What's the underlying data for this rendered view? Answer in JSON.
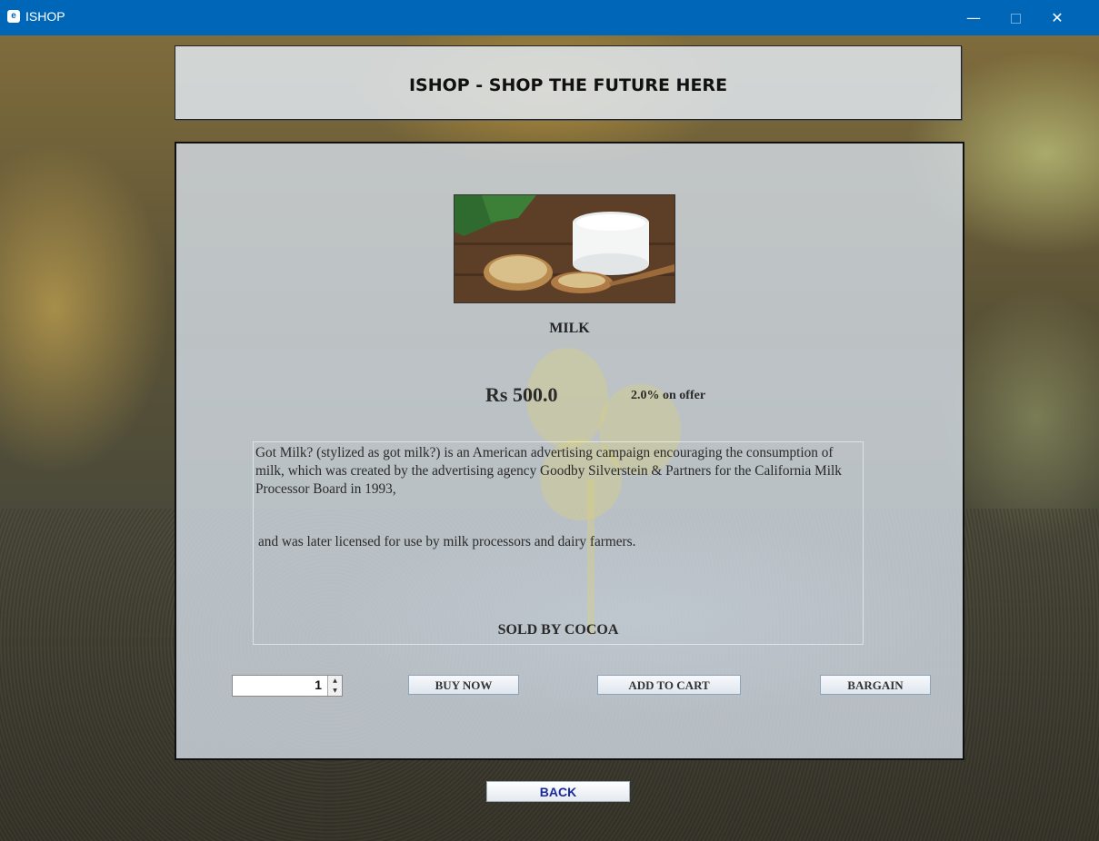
{
  "window": {
    "title": "ISHOP",
    "icon": "app-icon",
    "controls": {
      "minimize": "—",
      "maximize": "□",
      "close": "✕"
    }
  },
  "header": {
    "title": "ISHOP - SHOP THE FUTURE HERE"
  },
  "product": {
    "image_icon": "milk-glass-and-soybeans-image",
    "name": "MILK",
    "price": "Rs  500.0",
    "offer": "2.0% on offer",
    "description_p1": "Got Milk? (stylized as got milk?) is an American advertising campaign encouraging the consumption of milk, which was created by the advertising agency Goodby Silverstein & Partners for the California Milk Processor Board in 1993,",
    "description_p2": "and was later licensed for use by milk processors and dairy farmers.",
    "seller": "SOLD BY COCOA"
  },
  "actions": {
    "quantity": "1",
    "buy_now": "BUY NOW",
    "add_to_cart": "ADD TO CART",
    "bargain": "BARGAIN",
    "back": "BACK"
  },
  "colors": {
    "titlebar": "#0067b8",
    "back_text": "#1a2aa0"
  }
}
